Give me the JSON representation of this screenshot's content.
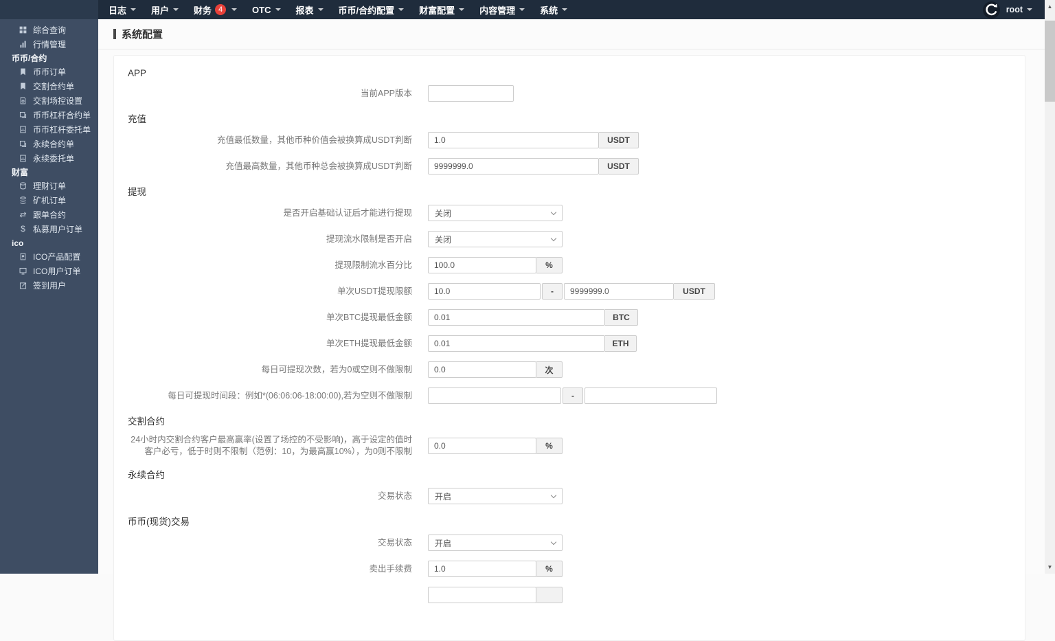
{
  "topbar": {
    "nav": [
      {
        "label": "日志"
      },
      {
        "label": "用户"
      },
      {
        "label": "财务",
        "badge": "4"
      },
      {
        "label": "OTC"
      },
      {
        "label": "报表"
      },
      {
        "label": "币币/合约配置"
      },
      {
        "label": "财富配置"
      },
      {
        "label": "内容管理"
      },
      {
        "label": "系统"
      }
    ],
    "user_name": "root"
  },
  "sidebar": {
    "entries": [
      {
        "label": "综合查询",
        "icon": "grid-icon"
      },
      {
        "label": "行情管理",
        "icon": "market-chart-icon"
      },
      {
        "label": "币币/合约"
      },
      {
        "label": "币币订单",
        "icon": "bookmark-icon"
      },
      {
        "label": "交割合约单",
        "icon": "bookmark-icon"
      },
      {
        "label": "交割场控设置",
        "icon": "file-gear-icon"
      },
      {
        "label": "币币杠杆合约单",
        "icon": "copy-icon"
      },
      {
        "label": "币币杠杆委托单",
        "icon": "file-chart-icon"
      },
      {
        "label": "永续合约单",
        "icon": "copy-icon"
      },
      {
        "label": "永续委托单",
        "icon": "file-chart-icon"
      },
      {
        "label": "财富"
      },
      {
        "label": "理财订单",
        "icon": "coins-icon"
      },
      {
        "label": "矿机订单",
        "icon": "stack-icon"
      },
      {
        "label": "跟单合约",
        "icon": "repeat-icon"
      },
      {
        "label": "私募用户订单",
        "icon": "dollar-icon"
      },
      {
        "label": "ico"
      },
      {
        "label": "ICO产品配置",
        "icon": "file-icon"
      },
      {
        "label": "ICO用户订单",
        "icon": "monitor-icon"
      },
      {
        "label": "签到用户",
        "icon": "edit-icon"
      }
    ]
  },
  "page": {
    "title": "系统配置"
  },
  "form": {
    "app": {
      "title": "APP",
      "version": {
        "label": "当前APP版本",
        "value": ""
      }
    },
    "recharge": {
      "title": "充值",
      "min": {
        "label": "充值最低数量，其他币种价值会被换算成USDT判断",
        "value": "1.0",
        "unit": "USDT"
      },
      "max": {
        "label": "充值最高数量，其他币种总会被换算成USDT判断",
        "value": "9999999.0",
        "unit": "USDT"
      }
    },
    "withdraw": {
      "title": "提现",
      "auth": {
        "label": "是否开启基础认证后才能进行提现",
        "value": "关闭"
      },
      "flow": {
        "label": "提现流水限制是否开启",
        "value": "关闭"
      },
      "percent": {
        "label": "提现限制流水百分比",
        "value": "100.0",
        "unit": "%"
      },
      "usdt": {
        "label": "单次USDT提现限额",
        "min": "10.0",
        "sep": "-",
        "max": "9999999.0",
        "unit": "USDT"
      },
      "btc": {
        "label": "单次BTC提现最低金额",
        "value": "0.01",
        "unit": "BTC"
      },
      "eth": {
        "label": "单次ETH提现最低金额",
        "value": "0.01",
        "unit": "ETH"
      },
      "count": {
        "label": "每日可提现次数，若为0或空则不做限制",
        "value": "0.0",
        "unit": "次"
      },
      "time": {
        "label": "每日可提现时间段：例如*(06:06:06-18:00:00),若为空则不做限制",
        "from": "",
        "sep": "-",
        "to": ""
      }
    },
    "delivery": {
      "title": "交割合约",
      "rate": {
        "label": "24小时内交割合约客户最高赢率(设置了场控的不受影响)，高于设定的值时客户必亏，低于时则不限制（范例：10，为最高赢10%），为0则不限制",
        "value": "0.0",
        "unit": "%"
      }
    },
    "perpetual": {
      "title": "永续合约",
      "status": {
        "label": "交易状态",
        "value": "开启"
      }
    },
    "spot": {
      "title": "币币(现货)交易",
      "status": {
        "label": "交易状态",
        "value": "开启"
      },
      "sellfee": {
        "label": "卖出手续费",
        "value": "1.0",
        "unit": "%"
      }
    }
  }
}
